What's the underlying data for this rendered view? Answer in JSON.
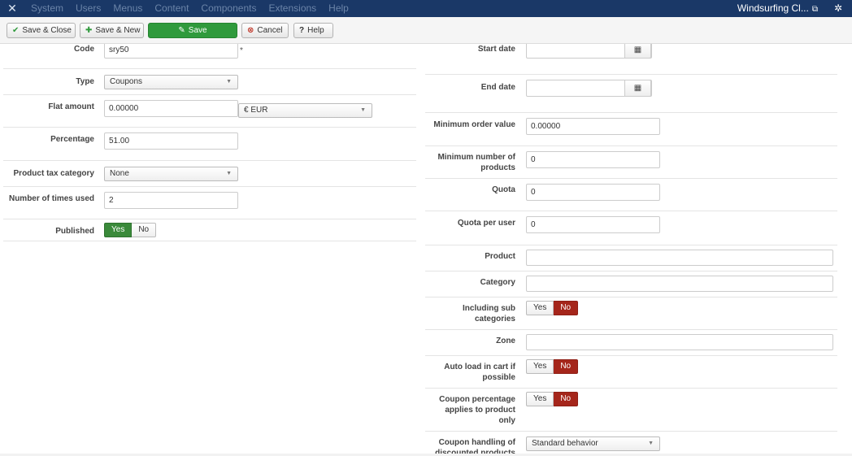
{
  "navbar": {
    "menu": [
      "System",
      "Users",
      "Menus",
      "Content",
      "Components",
      "Extensions",
      "Help"
    ],
    "site_name": "Windsurfing Cl..."
  },
  "toolbar": {
    "save_close": "Save & Close",
    "save_new": "Save & New",
    "save": "Save",
    "cancel": "Cancel",
    "help": "Help"
  },
  "left": {
    "code": {
      "label": "Code",
      "value": "sry50"
    },
    "type": {
      "label": "Type",
      "value": "Coupons"
    },
    "flat_amount": {
      "label": "Flat amount",
      "value": "0.00000",
      "currency": "€ EUR"
    },
    "percentage": {
      "label": "Percentage",
      "value": "51.00"
    },
    "tax_category": {
      "label": "Product tax category",
      "value": "None"
    },
    "times_used": {
      "label": "Number of times used",
      "value": "2"
    },
    "published": {
      "label": "Published",
      "yes": "Yes",
      "no": "No"
    }
  },
  "right": {
    "start_date": {
      "label": "Start date",
      "value": ""
    },
    "end_date": {
      "label": "End date",
      "value": ""
    },
    "min_order": {
      "label": "Minimum order value",
      "value": "0.00000"
    },
    "min_products": {
      "label": "Minimum number of products",
      "value": "0"
    },
    "quota": {
      "label": "Quota",
      "value": "0"
    },
    "quota_user": {
      "label": "Quota per user",
      "value": "0"
    },
    "product": {
      "label": "Product",
      "value": ""
    },
    "category": {
      "label": "Category",
      "value": ""
    },
    "including_sub": {
      "label": "Including sub categories",
      "yes": "Yes",
      "no": "No"
    },
    "zone": {
      "label": "Zone",
      "value": ""
    },
    "auto_load": {
      "label": "Auto load in cart if possible",
      "yes": "Yes",
      "no": "No"
    },
    "coupon_pct": {
      "label": "Coupon percentage applies to product only",
      "yes": "Yes",
      "no": "No"
    },
    "coupon_handling": {
      "label": "Coupon handling of discounted products",
      "value": "Standard behavior"
    }
  },
  "colors": {
    "navbar": "#1a3867",
    "save_green": "#2f9a3c",
    "yes_active": "#3a8a3a",
    "no_active": "#a5261b"
  }
}
